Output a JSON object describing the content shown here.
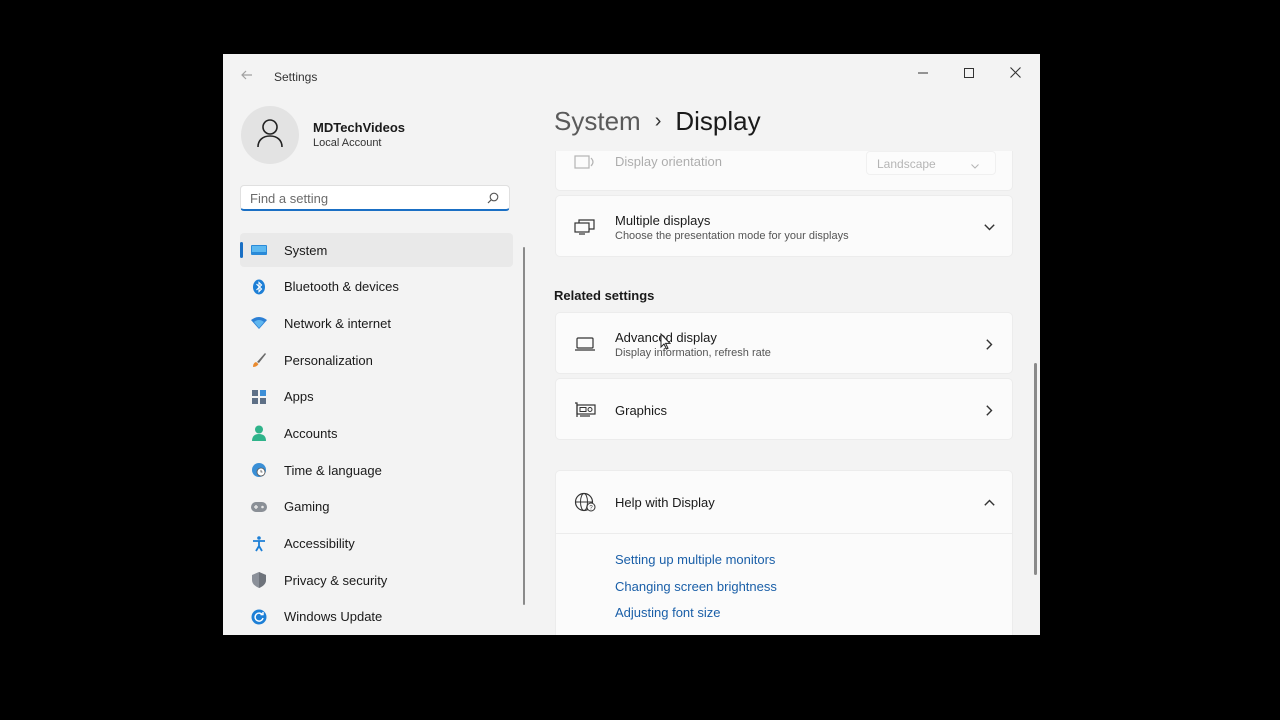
{
  "window": {
    "app_title": "Settings",
    "controls": {
      "back_icon": "back-arrow-icon",
      "minimize_icon": "minimize-icon",
      "maximize_icon": "maximize-icon",
      "close_icon": "close-icon"
    }
  },
  "account": {
    "name": "MDTechVideos",
    "type": "Local Account",
    "avatar_icon": "person-icon"
  },
  "search": {
    "placeholder": "Find a setting",
    "value": "",
    "icon": "search-icon"
  },
  "sidebar": {
    "items": [
      {
        "label": "System",
        "icon": "system-monitor-icon",
        "active": true
      },
      {
        "label": "Bluetooth & devices",
        "icon": "bluetooth-icon"
      },
      {
        "label": "Network & internet",
        "icon": "wifi-icon"
      },
      {
        "label": "Personalization",
        "icon": "brush-icon"
      },
      {
        "label": "Apps",
        "icon": "apps-icon"
      },
      {
        "label": "Accounts",
        "icon": "accounts-icon"
      },
      {
        "label": "Time & language",
        "icon": "globe-clock-icon"
      },
      {
        "label": "Gaming",
        "icon": "gamepad-icon"
      },
      {
        "label": "Accessibility",
        "icon": "accessibility-icon"
      },
      {
        "label": "Privacy & security",
        "icon": "shield-icon"
      },
      {
        "label": "Windows Update",
        "icon": "update-icon"
      }
    ]
  },
  "breadcrumb": {
    "parent": "System",
    "separator": "›",
    "current": "Display"
  },
  "main": {
    "orientation": {
      "title": "Display orientation",
      "value": "Landscape",
      "icon": "rotate-icon"
    },
    "multiple_displays": {
      "title": "Multiple displays",
      "subtitle": "Choose the presentation mode for your displays",
      "icon": "multiple-displays-icon"
    },
    "related_settings": {
      "title": "Related settings",
      "advanced_display": {
        "title": "Advanced display",
        "subtitle": "Display information, refresh rate",
        "icon": "laptop-icon"
      },
      "graphics": {
        "title": "Graphics",
        "icon": "graphics-card-icon"
      }
    },
    "help": {
      "title": "Help with Display",
      "icon": "globe-help-icon",
      "links": [
        "Setting up multiple monitors",
        "Changing screen brightness",
        "Adjusting font size"
      ]
    }
  },
  "colors": {
    "accent": "#1a6fc4",
    "link": "#1a5fa8",
    "window_bg": "#f3f3f3",
    "card_bg": "#fbfbfb"
  }
}
